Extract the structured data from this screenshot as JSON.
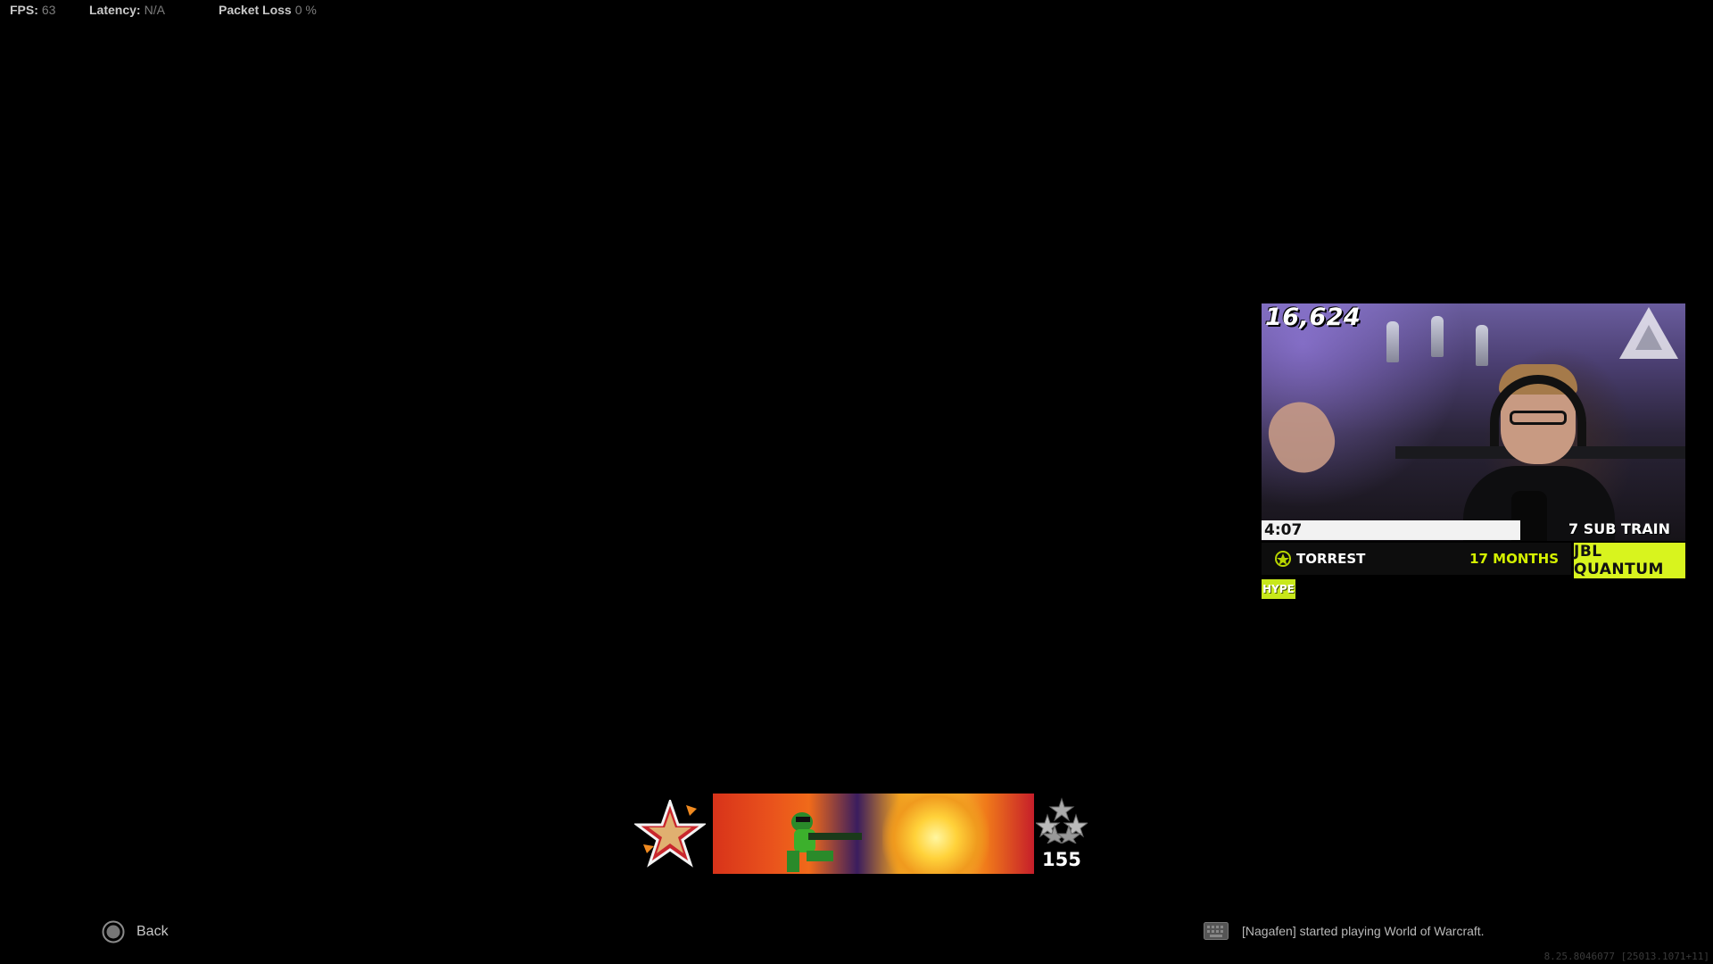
{
  "stats": [
    {
      "key": "FPS:",
      "value": "63"
    },
    {
      "key": "Latency:",
      "value": "N/A"
    },
    {
      "key": "Packet Loss",
      "value": "0 %"
    }
  ],
  "stream_overlay": {
    "viewer_count": "16,624",
    "timer": "4:07",
    "timer_progress": 0.61,
    "sub_train": "7 SUB TRAIN",
    "subscriber": {
      "name": "TORREST",
      "duration": "17 MONTHS"
    },
    "sponsor": "JBL QUANTUM",
    "hype": "HYPE",
    "webcam_logo_icon": "tfue-logo-icon",
    "colors": {
      "accent": "#d8f41e",
      "months_text": "#d4f000"
    }
  },
  "player_card": {
    "emblem_icon": "star-emblem-icon",
    "calling_card_icon": "comic-soldier-calling-card",
    "prestige_icon": "prestige-stars-icon",
    "level": "155"
  },
  "footer": {
    "back_label": "Back",
    "back_icon": "circle-button-icon",
    "notification_icon": "keyboard-icon",
    "notification": "[Nagafen] started playing World of Warcraft.",
    "build_string": "8.25.8046077 [25013.1071+11]"
  }
}
